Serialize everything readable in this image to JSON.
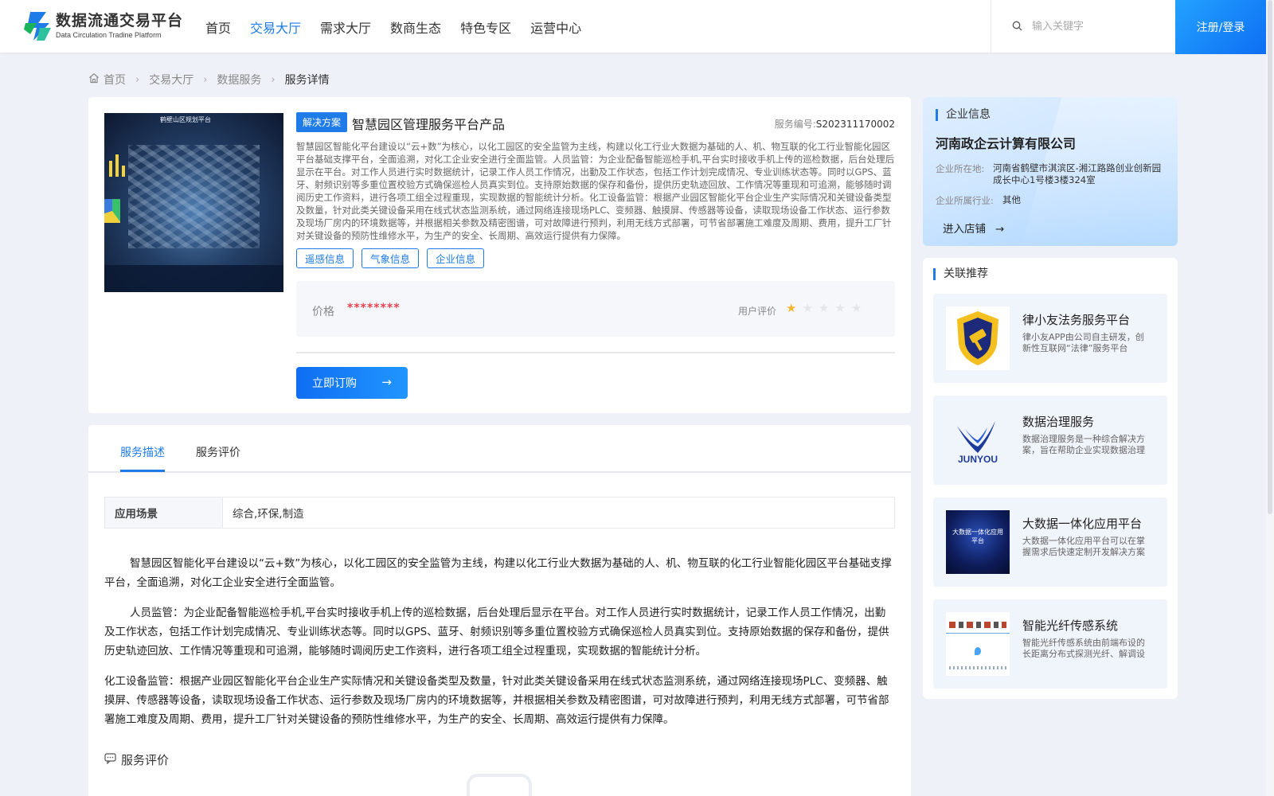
{
  "header": {
    "logo_title": "数据流通交易平台",
    "logo_sub": "Data Circulation Tradine Platform",
    "nav": [
      {
        "label": "首页",
        "active": false
      },
      {
        "label": "交易大厅",
        "active": true
      },
      {
        "label": "需求大厅",
        "active": false
      },
      {
        "label": "数商生态",
        "active": false
      },
      {
        "label": "特色专区",
        "active": false
      },
      {
        "label": "运营中心",
        "active": false
      }
    ],
    "search_placeholder": "输入关键字",
    "login_label": "注册/登录"
  },
  "breadcrumb": [
    "首页",
    "交易大厅",
    "数据服务",
    "服务详情"
  ],
  "product": {
    "image_title": "鹤壁山区规划平台",
    "badge": "解决方案",
    "title": "智慧园区管理服务平台产品",
    "service_no_label": "服务编号:",
    "service_no": "S202311170002",
    "description": "智慧园区智能化平台建设以“云+数”为核心，以化工园区的安全监管为主线，构建以化工行业大数据为基础的人、机、物互联的化工行业智能化园区平台基础支撑平台，全面追溯，对化工企业安全进行全面监管。人员监管：为企业配备智能巡检手机,平台实时接收手机上传的巡检数据，后台处理后显示在平台。对工作人员进行实时数据统计，记录工作人员工作情况，出勤及工作状态，包括工作计划完成情况、专业训练状态等。同时以GPS、蓝牙、射频识别等多重位置校验方式确保巡检人员真实到位。支持原始数据的保存和备份，提供历史轨迹回放、工作情况等重现和可追溯，能够随时调阅历史工作资料，进行各项工组全过程重现，实现数据的智能统计分析。化工设备监管：根据产业园区智能化平台企业生产实际情况和关键设备类型及数量，针对此类关键设备采用在线式状态监测系统，通过网络连接现场PLC、变频器、触摸屏、传感器等设备，读取现场设备工作状态、运行参数及现场厂房内的环境数据等，并根据相关参数及精密图谱，可对故障进行预判，利用无线方式部署，可节省部署施工难度及周期、费用，提升工厂针对关键设备的预防性维修水平，为生产的安全、长周期、高效运行提供有力保障。",
    "tags": [
      "遥感信息",
      "气象信息",
      "企业信息"
    ],
    "price_label": "价格",
    "price_value": "********",
    "rating_label": "用户评价",
    "rating": 1,
    "rating_max": 5,
    "buy_label": "立即订购"
  },
  "detail": {
    "tabs": [
      {
        "label": "服务描述",
        "active": true
      },
      {
        "label": "服务评价",
        "active": false
      }
    ],
    "scene_label": "应用场景",
    "scene_value": "综合,环保,制造",
    "paragraphs": [
      "智慧园区智能化平台建设以“云+数”为核心，以化工园区的安全监管为主线，构建以化工行业大数据为基础的人、机、物互联的化工行业智能化园区平台基础支撑平台，全面追溯，对化工企业安全进行全面监管。",
      "人员监管：为企业配备智能巡检手机,平台实时接收手机上传的巡检数据，后台处理后显示在平台。对工作人员进行实时数据统计，记录工作人员工作情况，出勤及工作状态，包括工作计划完成情况、专业训练状态等。同时以GPS、蓝牙、射频识别等多重位置校验方式确保巡检人员真实到位。支持原始数据的保存和备份，提供历史轨迹回放、工作情况等重现和可追溯，能够随时调阅历史工作资料，进行各项工组全过程重现，实现数据的智能统计分析。",
      "化工设备监管：根据产业园区智能化平台企业生产实际情况和关键设备类型及数量，针对此类关键设备采用在线式状态监测系统，通过网络连接现场PLC、变频器、触摸屏、传感器等设备，读取现场设备工作状态、运行参数及现场厂房内的环境数据等，并根据相关参数及精密图谱，可对故障进行预判，利用无线方式部署，可节省部署施工难度及周期、费用，提升工厂针对关键设备的预防性维修水平，为生产的安全、长周期、高效运行提供有力保障。"
    ],
    "review_heading": "服务评价"
  },
  "company": {
    "section_title": "企业信息",
    "name": "河南政企云计算有限公司",
    "location_label": "企业所在地:",
    "location": "河南省鹤壁市淇滨区-湘江路路创业创新园成长中心1号楼3楼324室",
    "industry_label": "企业所属行业:",
    "industry": "其他",
    "enter_label": "进入店铺"
  },
  "recommend": {
    "section_title": "关联推荐",
    "items": [
      {
        "title": "律小友法务服务平台",
        "desc": "律小友APP由公司自主研发，创新性互联网“法律”服务平台"
      },
      {
        "title": "数据治理服务",
        "desc": "数据治理服务是一种综合解决方案，旨在帮助企业实现数据治理"
      },
      {
        "title": "大数据一体化应用平台",
        "desc": "大数据一体化应用平台可以在掌握需求后快速定制开发解决方案"
      },
      {
        "title": "智能光纤传感系统",
        "desc": "智能光纤传感系统由前端布设的长距离分布式探测光纤、解调设备"
      }
    ],
    "thumb_texts": [
      "",
      "JUNYOU",
      "大数据一体化应用平台",
      ""
    ]
  },
  "colors": {
    "accent": "#1e7be8",
    "price": "#e8414e",
    "star_on": "#f5b631",
    "star_off": "#e4e6ea"
  }
}
